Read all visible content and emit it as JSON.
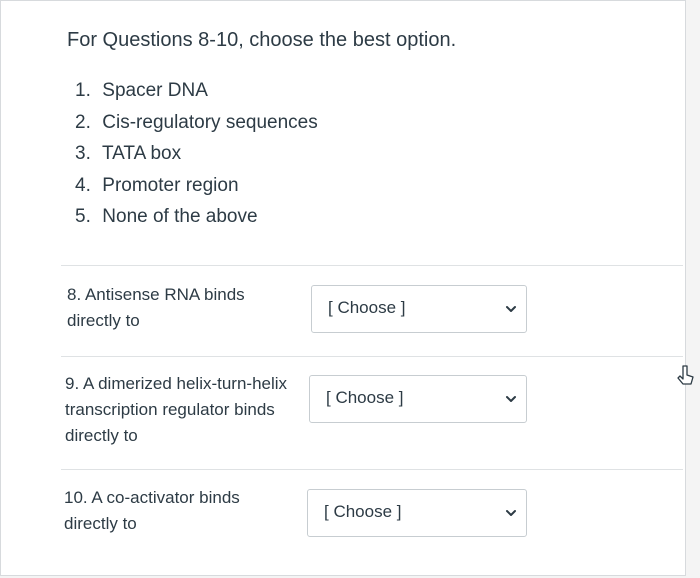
{
  "prompt": "For Questions 8-10, choose the best option.",
  "options": [
    {
      "num": "1.",
      "label": "Spacer DNA"
    },
    {
      "num": "2.",
      "label": "Cis-regulatory sequences"
    },
    {
      "num": "3.",
      "label": "TATA box"
    },
    {
      "num": "4.",
      "label": "Promoter region"
    },
    {
      "num": "5.",
      "label": "None of the above"
    }
  ],
  "questions": [
    {
      "text_line1": "8. Antisense RNA binds",
      "text_line2": "directly to",
      "text_line3": "",
      "selected": "[ Choose ]"
    },
    {
      "text_line1": "9. A dimerized helix-turn-helix",
      "text_line2": "transcription regulator binds",
      "text_line3": "directly to",
      "selected": "[ Choose ]"
    },
    {
      "text_line1": "10. A co-activator binds",
      "text_line2": "directly to",
      "text_line3": "",
      "selected": "[ Choose ]"
    }
  ],
  "icons": {
    "dropdown": "chevron-down-icon",
    "pointer": "mouse-pointer-icon"
  }
}
